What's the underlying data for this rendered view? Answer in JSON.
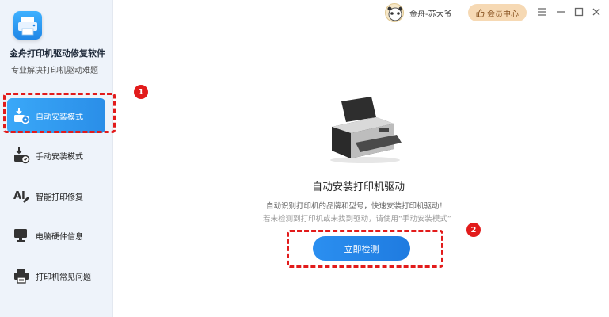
{
  "app": {
    "name": "金舟打印机驱动修复软件",
    "subtitle": "专业解决打印机驱动难题"
  },
  "sidebar": {
    "items": [
      {
        "label": "自动安装模式",
        "icon": "download-install-icon",
        "active": true
      },
      {
        "label": "手动安装模式",
        "icon": "manual-install-icon",
        "active": false
      },
      {
        "label": "智能打印修复",
        "icon": "smart-repair-icon",
        "active": false
      },
      {
        "label": "电脑硬件信息",
        "icon": "computer-hardware-icon",
        "active": false
      },
      {
        "label": "打印机常见问题",
        "icon": "printer-faq-icon",
        "active": false
      }
    ]
  },
  "header": {
    "user_name": "金舟-苏大爷",
    "member_label": "会员中心",
    "controls": [
      "menu-icon",
      "minimize-icon",
      "maximize-icon",
      "close-icon"
    ]
  },
  "main": {
    "title": "自动安装打印机驱动",
    "desc_line1": "自动识别打印机的品牌和型号，快速安装打印机驱动！",
    "desc_line2": "若未检测到打印机或未找到驱动，请使用“手动安装模式”",
    "detect_button": "立即检测"
  },
  "annotations": {
    "badge1": "1",
    "badge2": "2"
  },
  "colors": {
    "accent": "#2a8ee8",
    "highlight": "#e21b1b",
    "member_bg": "#f6d9b4",
    "sidebar_bg": "#eef3fa"
  }
}
